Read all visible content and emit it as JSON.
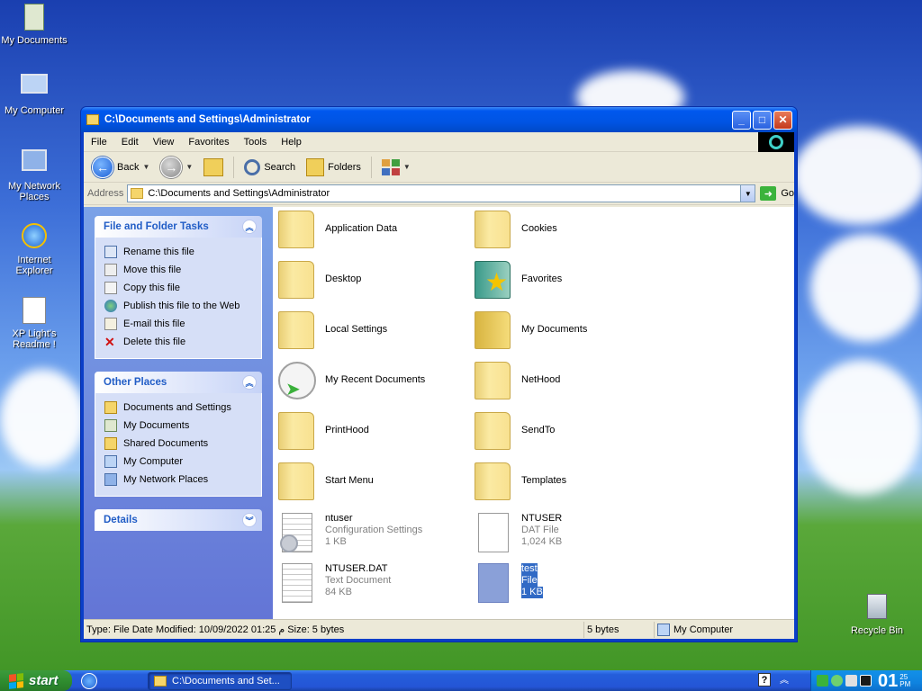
{
  "desktop": {
    "icons": [
      {
        "label": "My Documents"
      },
      {
        "label": "My Computer"
      },
      {
        "label": "My Network Places"
      },
      {
        "label": "Internet Explorer"
      },
      {
        "label": "XP Light's Readme !"
      },
      {
        "label": "Recycle Bin"
      }
    ]
  },
  "window": {
    "title": "C:\\Documents and Settings\\Administrator",
    "menu": [
      "File",
      "Edit",
      "View",
      "Favorites",
      "Tools",
      "Help"
    ],
    "toolbar": {
      "back": "Back",
      "search": "Search",
      "folders": "Folders"
    },
    "address": {
      "label": "Address",
      "value": "C:\\Documents and Settings\\Administrator",
      "go": "Go"
    },
    "tasks": {
      "file_tasks_title": "File and Folder Tasks",
      "file_tasks": [
        "Rename this file",
        "Move this file",
        "Copy this file",
        "Publish this file to the Web",
        "E-mail this file",
        "Delete this file"
      ],
      "other_places_title": "Other Places",
      "other_places": [
        "Documents and Settings",
        "My Documents",
        "Shared Documents",
        "My Computer",
        "My Network Places"
      ],
      "details_title": "Details"
    },
    "files": [
      {
        "name": "Application Data"
      },
      {
        "name": "Cookies"
      },
      {
        "name": "Desktop"
      },
      {
        "name": "Favorites"
      },
      {
        "name": "Local Settings"
      },
      {
        "name": "My Documents"
      },
      {
        "name": "My Recent Documents"
      },
      {
        "name": "NetHood"
      },
      {
        "name": "PrintHood"
      },
      {
        "name": "SendTo"
      },
      {
        "name": "Start Menu"
      },
      {
        "name": "Templates"
      },
      {
        "name": "ntuser",
        "type": "Configuration Settings",
        "size": "1 KB"
      },
      {
        "name": "NTUSER",
        "type": "DAT File",
        "size": "1,024 KB"
      },
      {
        "name": "NTUSER.DAT",
        "type": "Text Document",
        "size": "84 KB"
      },
      {
        "name": "test",
        "type": "File",
        "size": "1 KB"
      }
    ],
    "status": {
      "info": "Type: File Date Modified: 10/09/2022 01:25 م Size: 5 bytes",
      "size": "5 bytes",
      "zone": "My Computer"
    }
  },
  "taskbar": {
    "start": "start",
    "task_title": "C:\\Documents and Set...",
    "clock_hour": "01",
    "clock_min": "25",
    "clock_ampm": "PM"
  }
}
